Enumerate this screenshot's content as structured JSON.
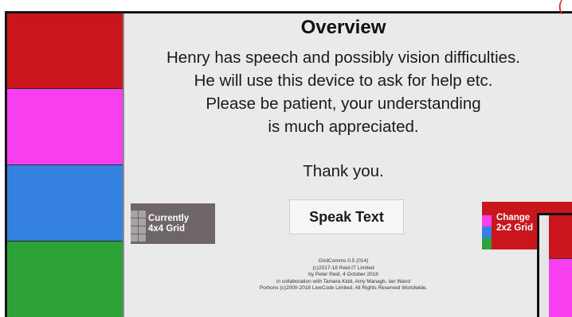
{
  "overview": {
    "title": "Overview",
    "message_lines": [
      "Henry has speech and possibly vision difficulties.",
      "He will use this device to ask for help etc.",
      "Please be patient, your understanding",
      "is much appreciated."
    ],
    "thanks": "Thank you."
  },
  "buttons": {
    "current_grid_line1": "Currently",
    "current_grid_line2": "4x4 Grid",
    "speak_text": "Speak Text",
    "change_grid_line1": "Change",
    "change_grid_line2": "2x2 Grid"
  },
  "sidebar": {
    "tiles": [
      {
        "name": "red",
        "color": "#c8161c"
      },
      {
        "name": "magenta",
        "color": "#f73ff0"
      },
      {
        "name": "blue",
        "color": "#3581e0"
      },
      {
        "name": "green",
        "color": "#2da337"
      }
    ]
  },
  "credits": {
    "lines": [
      "GridComms 0.5 (014)",
      "(c)2017-18 Reid-IT Limited",
      "by Peter Reid, 4 October 2018",
      "in collaboration with Tamara Kidd, Amy Managh, Ian Wand",
      "Portions (c)2000-2018 LiveCode Limited. All Rights Reserved Worldwide."
    ]
  },
  "annotation": {
    "mark": "("
  }
}
